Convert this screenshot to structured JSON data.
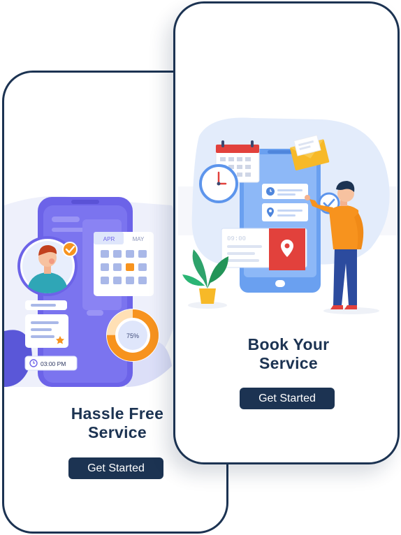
{
  "screens": [
    {
      "title_line1": "Hassle Free",
      "title_line2": "Service",
      "cta_label": "Get Started",
      "illustration": {
        "calendar_months": [
          "APR",
          "MAY"
        ],
        "progress_percent": 75,
        "progress_label": "75%",
        "time_label": "03:00 PM",
        "icons": [
          "avatar",
          "check-icon",
          "star-icon",
          "clock-icon",
          "calendar-icon"
        ]
      }
    },
    {
      "title_line1": "Book Your",
      "title_line2": "Service",
      "cta_label": "Get Started",
      "illustration": {
        "card_time_label": "09:00",
        "icons": [
          "calendar-icon",
          "wall-clock-icon",
          "envelope-icon",
          "map-pin-icon",
          "check-icon",
          "plant-icon",
          "person"
        ]
      }
    }
  ],
  "colors": {
    "navy": "#1c3352",
    "purple": "#6c63e8",
    "orange": "#f7931e",
    "light_blue": "#e2edfb",
    "red": "#e2413c"
  }
}
